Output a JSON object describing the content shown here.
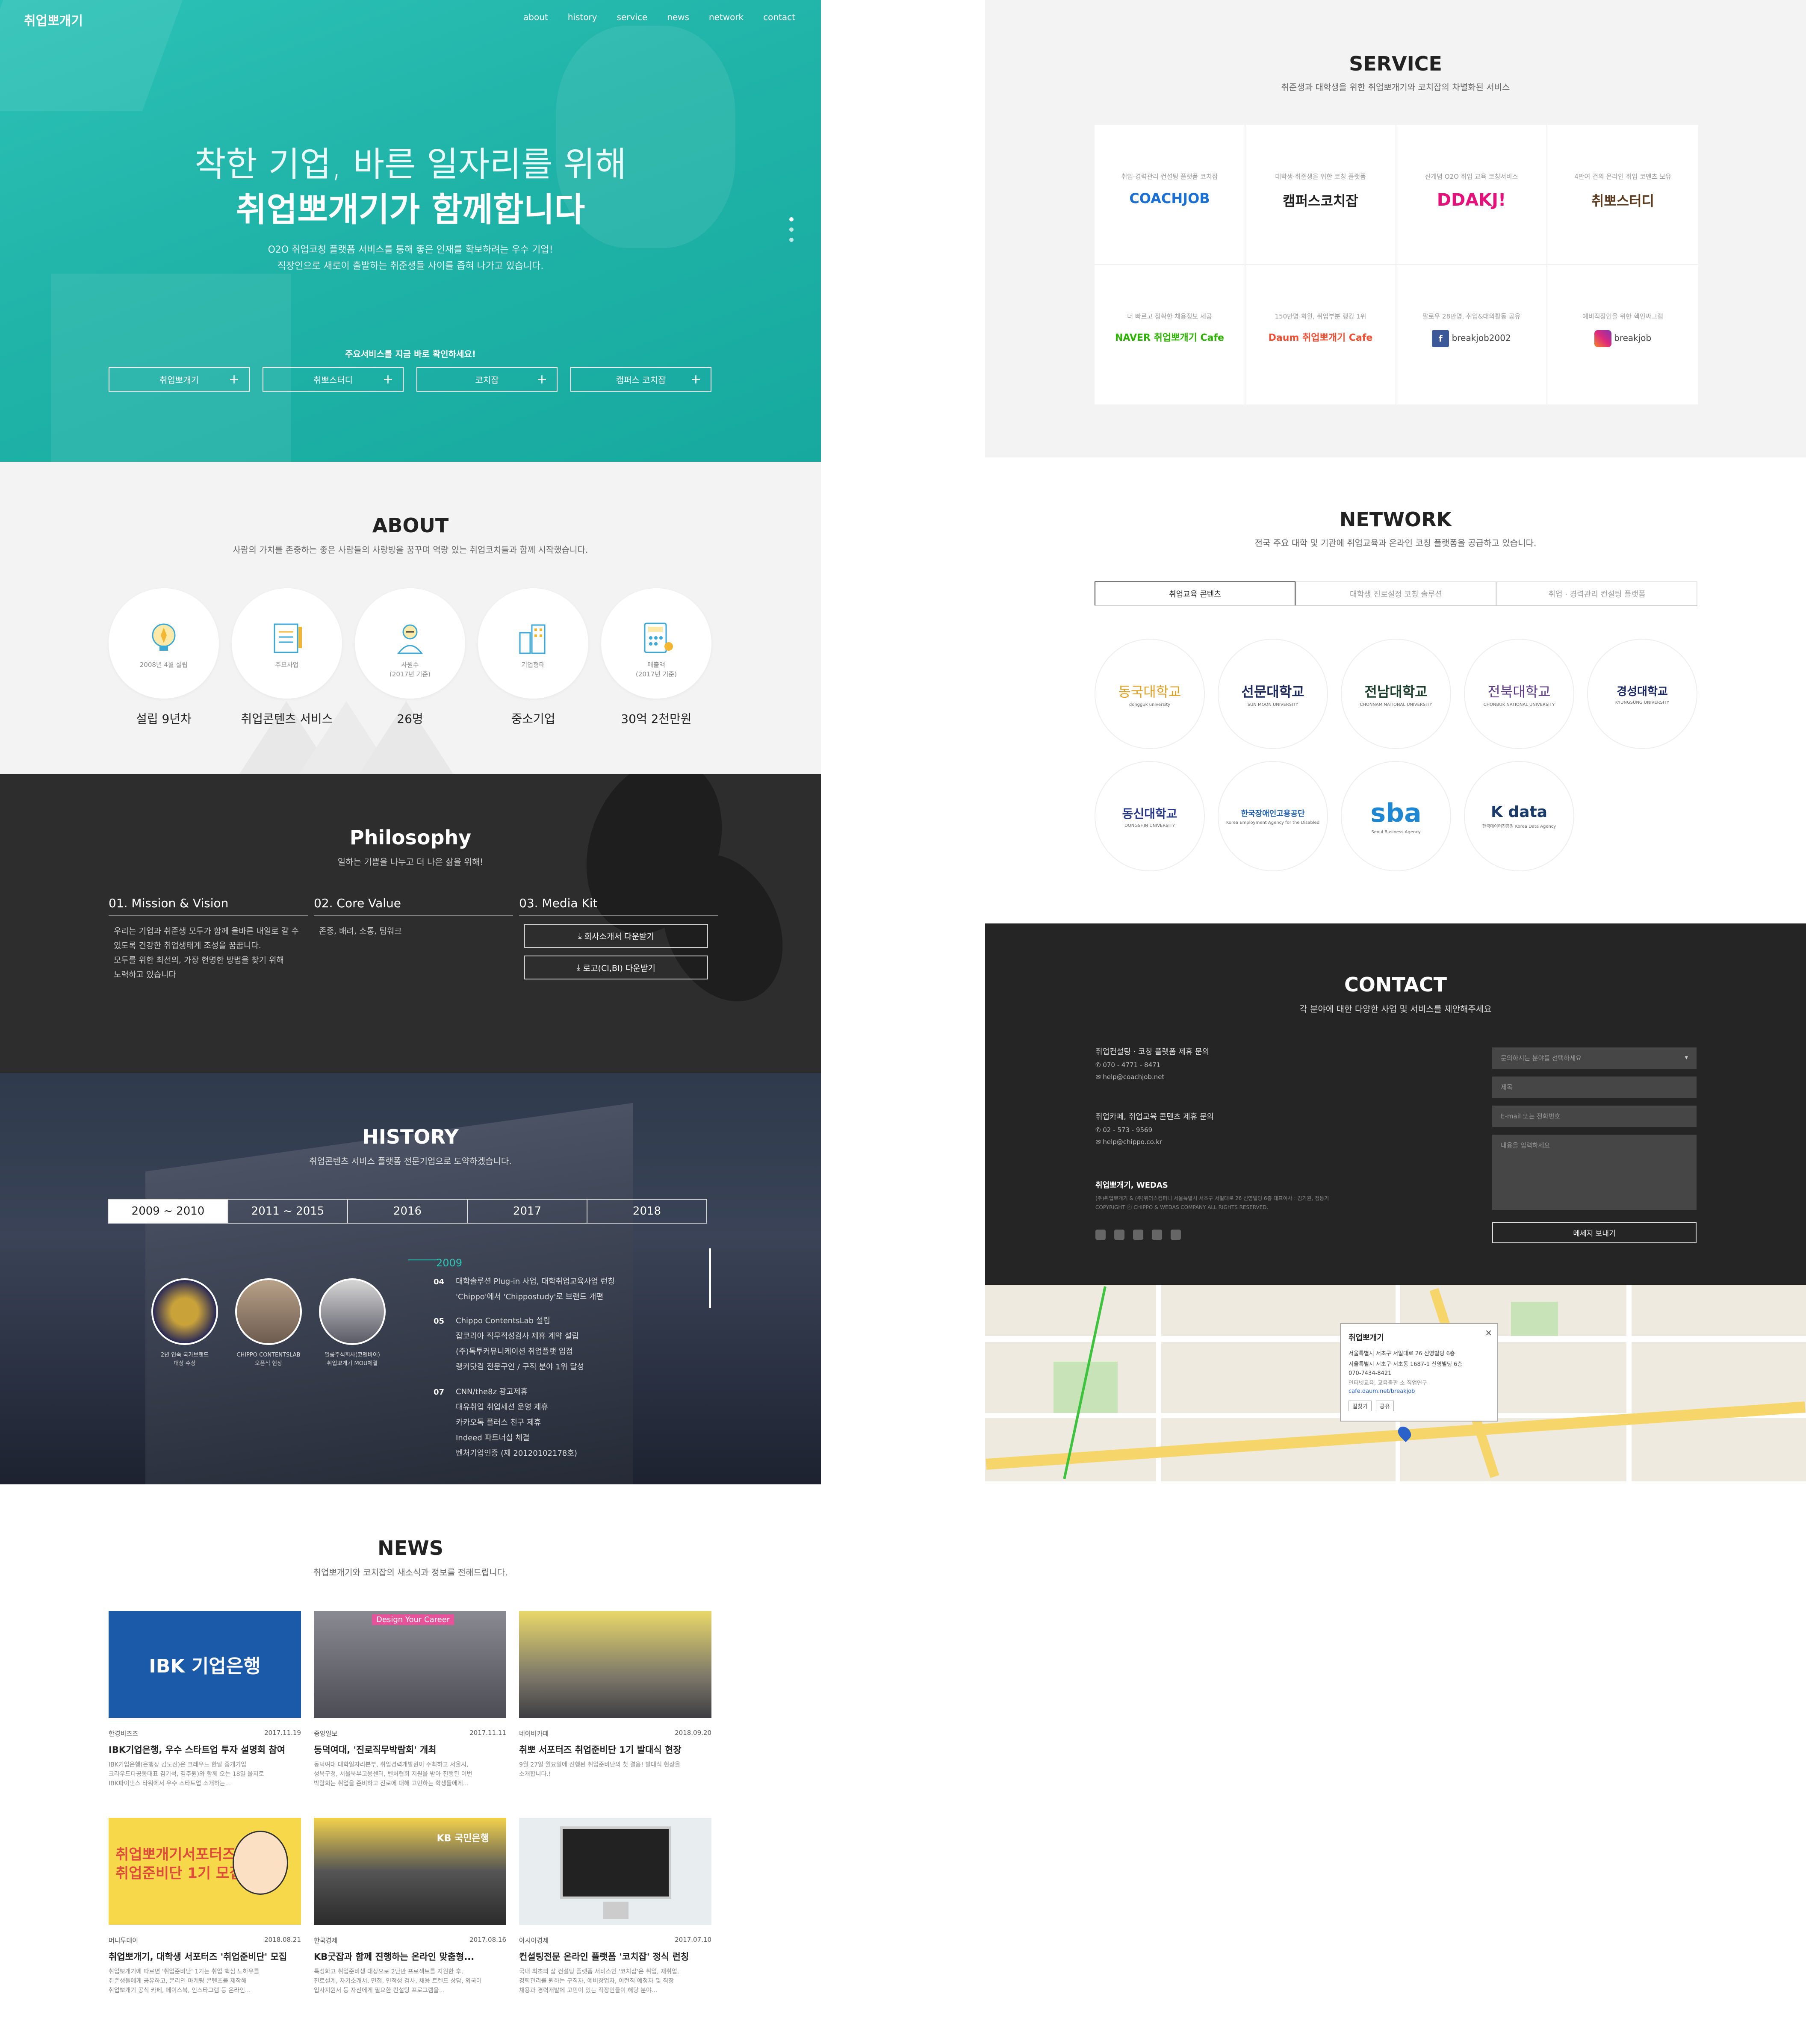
{
  "hero": {
    "logo": "취업뽀개기",
    "nav": [
      "about",
      "history",
      "service",
      "news",
      "network",
      "contact"
    ],
    "headline1": "착한 기업, 바른 일자리를 위해",
    "headline2": "취업뽀개기가 함께합니다",
    "sub1": "O2O 취업코칭 플랫폼 서비스를 통해 좋은 인재를 확보하려는 우수 기업!",
    "sub2": "직장인으로 새로이 출발하는 취준생들 사이를 좁혀 나가고 있습니다.",
    "cta": "주요서비스를 지금 바로 확인하세요!",
    "buttons": [
      "취업뽀개기",
      "취뽀스터디",
      "코치잡",
      "캠퍼스 코치잡"
    ]
  },
  "about": {
    "title": "ABOUT",
    "subtitle": "사람의 가치를 존중하는 좋은 사람들의 사랑방을 꿈꾸며 역량 있는 취업코치들과 함께 시작했습니다.",
    "items": [
      {
        "caption": "2008년 4월 설립",
        "value": "설립 9년차",
        "icon": "lightbulb-icon"
      },
      {
        "caption": "주요사업",
        "value": "취업콘텐츠 서비스",
        "icon": "notepad-icon"
      },
      {
        "caption": "사원수\n(2017년 기준)",
        "value": "26명",
        "icon": "person-icon"
      },
      {
        "caption": "기업형태",
        "value": "중소기업",
        "icon": "building-icon"
      },
      {
        "caption": "매출액\n(2017년 기준)",
        "value": "30억 2천만원",
        "icon": "calculator-icon"
      }
    ]
  },
  "philosophy": {
    "title": "Philosophy",
    "subtitle": "일하는 기쁨을 나누고 더 나은 삶을 위해!",
    "cols": [
      {
        "head": "01. Mission & Vision",
        "body": "우리는 기업과 취준생 모두가 함께 올바른 내일로 갈 수\n있도록 건강한 취업생태계 조성을 꿈꿉니다.\n모두를 위한 최선의, 가장 현명한 방법을 찾기 위해\n노력하고 있습니다"
      },
      {
        "head": "02. Core Value",
        "body": "존중, 배려, 소통, 팀워크"
      },
      {
        "head": "03. Media Kit",
        "body": ""
      }
    ],
    "downloads": [
      "회사소개서 다운받기",
      "로고(CI,BI) 다운받기"
    ]
  },
  "history": {
    "title": "HISTORY",
    "subtitle": "취업콘텐츠 서비스 플랫폼 전문기업으로 도약하겠습니다.",
    "tabs": [
      "2009 ~ 2010",
      "2011 ~ 2015",
      "2016",
      "2017",
      "2018"
    ],
    "active_tab": "2009 ~ 2010",
    "year": "2009",
    "badges": [
      {
        "caption": "2년 연속 국가브랜드\n대상 수상"
      },
      {
        "caption": "CHIPPO CONTENTSLAB\n오픈식 현장"
      },
      {
        "caption": "일룸주식회사(코멘바이)\n취업뽀개기 MOU체결"
      }
    ],
    "events": [
      {
        "month": "04",
        "text": "대학솔루션 Plug-in 사업, 대학취업교육사업 런칭\n'Chippo'에서 'Chippostudy'로 브랜드 개편"
      },
      {
        "month": "05",
        "text": "Chippo ContentsLab 설립\n잡코리아 직무적성검사 제휴 계약 설립\n(주)톡투커뮤니케이션 취업플랫 입점\n랭커닷컴 전문구인 / 구직 분야 1위 달성"
      },
      {
        "month": "07",
        "text": "CNN/the8z 광고제휴\n대유취업 취업세션 운영 제휴\n카카오톡 플러스 친구 제휴\nIndeed 파트너십 체결\n벤처기업인증 (제 20120102178호)"
      }
    ]
  },
  "news": {
    "title": "NEWS",
    "subtitle": "취업뽀개기와 코치잡의 새소식과 정보를 전해드립니다.",
    "cards": [
      {
        "source": "한경비즈즈",
        "date": "2017.11.19",
        "title": "IBK기업은행, 우수 스타트업 투자 설명회 참여",
        "desc": "IBK기업은행(은행장 김도진)은 크레우드 한달 중개기업\n크라우드다공동대표 김기석, 김주원)와 함께 오는 18일 울지로\nIBK파이낸스 타워에서 우수 스타트업 소개하는...",
        "img_label": "IBK 기업은행"
      },
      {
        "source": "중앙일보",
        "date": "2017.11.11",
        "title": "동덕여대, '진로직무박람회' 개최",
        "desc": "동덕여대 대학일자리본부, 취업경력개발원이 주최하고 서울시,\n성북구청, 서울북부고용센터, 벤처협회 지원을 받아 진행된 이번\n박람회는 취업을 준비하고 진로에 대해 고민하는 학생들에게...",
        "img_label": "Design Your Career"
      },
      {
        "source": "네이버카페",
        "date": "2018.09.20",
        "title": "취뽀 서포터즈 취업준비단 1기 발대식 현장",
        "desc": "9월 27일 월요일에 진행된 취업준비단의 첫 결음! 발대식 현장을\n소개합니다.!",
        "img_label": ""
      },
      {
        "source": "머니투데이",
        "date": "2018.08.21",
        "title": "취업뽀개기, 대학생 서포터즈 '취업준비단' 모집",
        "desc": "취업뽀개기에 따르면 '취업준비단' 1기는 취업 핵심 노하우를\n취준생들에게 공유하고, 온라인 마케팅 콘텐츠를 제작해\n취업뽀개기 공식 카페, 페이스북, 인스타그램 등 온라인...",
        "img_label": "취업뽀개기서포터즈\n취업준비단 1기 모집"
      },
      {
        "source": "한국경제",
        "date": "2017.08.16",
        "title": "KB굿잡과 함께 진행하는 온라인 맞춤형...",
        "desc": "특성화고 취업준비생 대상으로 2단만 프로젝트를 지원한 후,\n진로설계, 자기소개서, 면접, 인적성 검사, 채용 트렌드 상담, 외국어\n입사지원서 등 자신에게 필요한 컨설팅 프로그램을...",
        "img_label": "KB 국민은행"
      },
      {
        "source": "아시아경제",
        "date": "2017.07.10",
        "title": "컨설팅전문 온라인 플랫폼 '코치잡' 정식 런칭",
        "desc": "국내 최초의 잡 컨설팅 플랫폼 서비스인 '코치잡'은 취업, 재취업,\n경력관리를 원하는 구직자, 예비창업자, 이런직 예정자 및 직장\n채용과 경력개발에 고민이 있는 직장인들이 해당 분야...",
        "img_label": ""
      }
    ]
  },
  "service": {
    "title": "SERVICE",
    "subtitle": "취준생과 대학생을 위한 취업뽀개기와 코치잡의 차별화된 서비스",
    "cells": [
      {
        "desc": "취업·경력관리 컨설팅 플랫폼 코치잡",
        "logo": "COACHJOB",
        "color": "#1a6fd6"
      },
      {
        "desc": "대학생·취준생을 위한 코칭 플랫폼",
        "logo": "캠퍼스코치잡",
        "color": "#1a6fd6"
      },
      {
        "desc": "신개념 O2O 취업 교육 코칭서비스",
        "logo": "DDAKJ!",
        "color": "#e4117a"
      },
      {
        "desc": "4만여 건의 온라인 취업 코멘츠 보유",
        "logo": "취뽀스터디",
        "color": "#5b3a1e"
      },
      {
        "desc": "더 빠르고 정확한 채용정보 제공",
        "logo": "NAVER 취업뽀개기 Cafe",
        "color": "#2db400"
      },
      {
        "desc": "150만명 회원, 취업부분 랭킹 1위",
        "logo": "Daum 취업뽀개기 Cafe",
        "color": "#f24e32"
      },
      {
        "desc": "팔로우 28만명, 취업&대외활동 공유",
        "logo": "breakjob2002",
        "color": "#3b5998"
      },
      {
        "desc": "예비직장인을 위한 핵인싸그램",
        "logo": "breakjob",
        "color": "#c13584"
      }
    ]
  },
  "network": {
    "title": "NETWORK",
    "subtitle": "전국 주요 대학 및 기관에 취업교육과 온라인 코칭 플랫폼을 공급하고 있습니다.",
    "tabs": [
      "취업교육 콘텐츠",
      "대학생 진로설정 코칭 솔루션",
      "취업 · 경력관리 컨설팅 플랫폼"
    ],
    "partners": [
      {
        "name": "동국대학교",
        "en": "dongguk university",
        "color": "#e0a021"
      },
      {
        "name": "선문대학교",
        "en": "SUN MOON UNIVERSITY",
        "color": "#1f2a5c"
      },
      {
        "name": "전남대학교",
        "en": "CHONNAM NATIONAL UNIVERSITY",
        "color": "#1c3f2e"
      },
      {
        "name": "전북대학교",
        "en": "CHONBUK NATIONAL UNIVERSITY",
        "color": "#5e3a8a"
      },
      {
        "name": "경성대학교",
        "en": "KYUNGSUNG UNIVERSITY",
        "color": "#1b2a66"
      },
      {
        "name": "동신대학교",
        "en": "DONGSHIN UNIVERSITY",
        "color": "#2a3a8a"
      },
      {
        "name": "한국장애인고용공단",
        "en": "Korea Employment Agency for the Disabled",
        "color": "#1d5fae"
      },
      {
        "name": "sba",
        "en": "Seoul Business Agency",
        "color": "#1f86d1"
      },
      {
        "name": "K data",
        "en": "한국데이터진흥원 Korea Data Agency",
        "color": "#1a3a6a"
      }
    ]
  },
  "contact": {
    "title": "CONTACT",
    "subtitle": "각 분야에 대한 다양한 사업 및 서비스를 제안해주세요",
    "blocks": [
      {
        "head": "취업컨설팅 · 코칭 플랫폼 제휴 문의",
        "phone": "070 - 4771 - 8471",
        "email": "help@coachjob.net"
      },
      {
        "head": "취업카페, 취업교육 콘텐츠 제휴 문의",
        "phone": "02 - 573 - 9569",
        "email": "help@chippo.co.kr"
      }
    ],
    "company": "취업뽀개기, WEDAS",
    "address": "(주)취업뽀개기 & (주)위더스컴퍼니 서울특별시 서초구 서일대로 26 신영빌딩 6층      대표이사 : 김기원, 정동기",
    "copyright": "COPYRIGHT ⓒ CHIPPO & WEDAS COMPANY ALL RIGHTS RESERVED.",
    "select_placeholder": "문의하시는 분야를 선택하세요",
    "title_placeholder": "제목",
    "email_placeholder": "E-mail 또는 전화번호",
    "message_placeholder": "내용을 입력하세요",
    "send": "메세지 보내기"
  },
  "map": {
    "place": "취업뽀개기",
    "addr1": "서울특별시 서초구 서일대로 26 신영빌딩 6층",
    "addr2": "서울특별시 서초구 서초동 1687-1 신영빌딩 6층",
    "phone": "070-7434-8421",
    "tags": "인터넷교육, 교육출판 소 직업연구",
    "link": "cafe.daum.net/breakjob",
    "btn1": "길찾기",
    "btn2": "공유"
  }
}
